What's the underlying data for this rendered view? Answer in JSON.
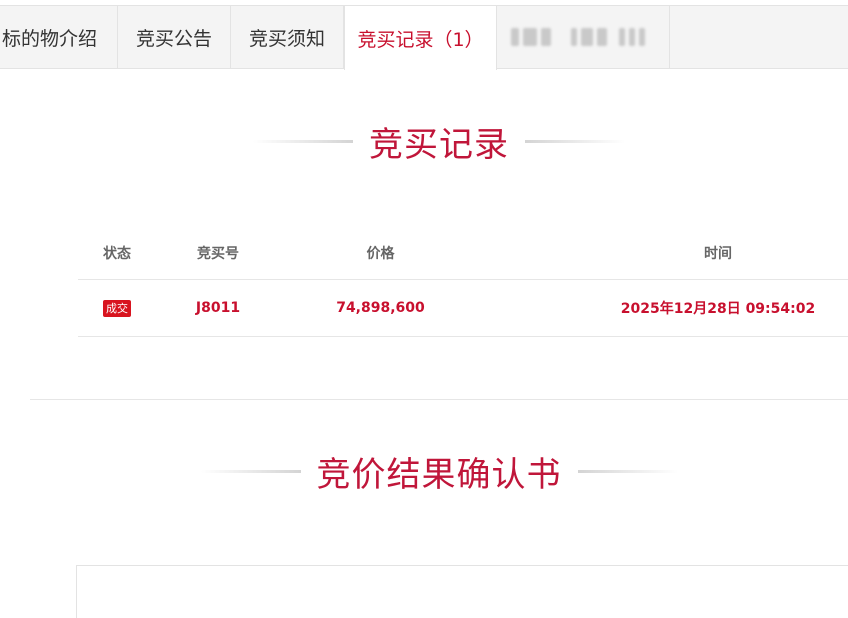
{
  "tabs": [
    {
      "label": "标的物介绍"
    },
    {
      "label": "竞买公告"
    },
    {
      "label": "竞买须知"
    },
    {
      "label": "竞买记录（1）"
    }
  ],
  "records_section": {
    "title": "竞买记录",
    "columns": [
      "状态",
      "竞买号",
      "价格",
      "时间"
    ],
    "rows": [
      {
        "status": "成交",
        "bid_no": "J8011",
        "price": "74,898,600",
        "time": "2025年12月28日 09:54:02"
      }
    ]
  },
  "result_section": {
    "title": "竞价结果确认书"
  },
  "colors": {
    "accent": "#c8102e",
    "badge": "#d8141f"
  }
}
